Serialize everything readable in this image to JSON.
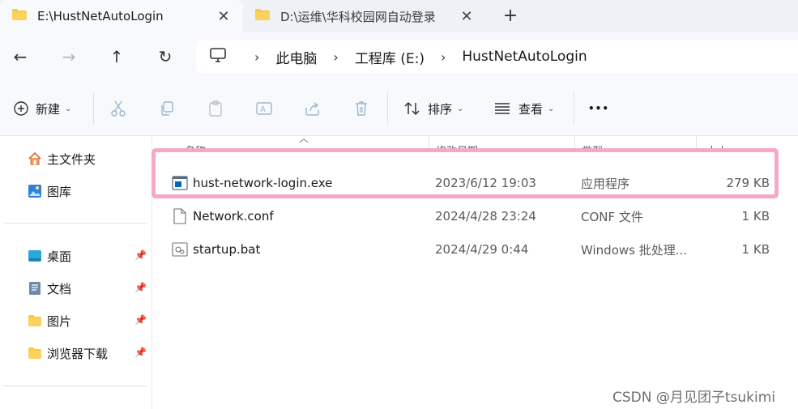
{
  "tabs": [
    {
      "title": "E:\\HustNetAutoLogin",
      "close": "✕",
      "active": true
    },
    {
      "title": "D:\\运维\\华科校园网自动登录",
      "close": "✕",
      "active": false
    }
  ],
  "new_tab_glyph": "+",
  "nav": {
    "back": "←",
    "forward": "→",
    "up": "↑",
    "refresh": "↻"
  },
  "address": {
    "separator": "›",
    "crumbs": [
      "此电脑",
      "工程库 (E:)",
      "HustNetAutoLogin"
    ]
  },
  "toolbar": {
    "new_label": "新建",
    "sort_label": "排序",
    "view_label": "查看",
    "more_label": "•••"
  },
  "sidebar": {
    "quick": [
      {
        "label": "主文件夹",
        "icon": "home-icon"
      },
      {
        "label": "图库",
        "icon": "gallery-icon"
      }
    ],
    "pinned": [
      {
        "label": "桌面",
        "icon": "desktop-folder-icon"
      },
      {
        "label": "文档",
        "icon": "documents-folder-icon"
      },
      {
        "label": "图片",
        "icon": "pictures-folder-icon"
      },
      {
        "label": "浏览器下载",
        "icon": "folder-icon"
      }
    ]
  },
  "columns": {
    "name": "名称",
    "date": "修改日期",
    "type": "类型",
    "size": "大小"
  },
  "files": [
    {
      "name": "hust-network-login.exe",
      "date": "2023/6/12 19:03",
      "type": "应用程序",
      "size": "279 KB",
      "icon": "exe-file-icon"
    },
    {
      "name": "Network.conf",
      "date": "2024/4/28 23:24",
      "type": "CONF 文件",
      "size": "1 KB",
      "icon": "generic-file-icon"
    },
    {
      "name": "startup.bat",
      "date": "2024/4/29 0:44",
      "type": "Windows 批处理...",
      "size": "1 KB",
      "icon": "batch-file-icon"
    }
  ],
  "watermark": "CSDN @月见团子tsukimi",
  "colors": {
    "accent": "#0067c0",
    "highlight": "#f6a8c8",
    "folder": "#f8c846"
  }
}
